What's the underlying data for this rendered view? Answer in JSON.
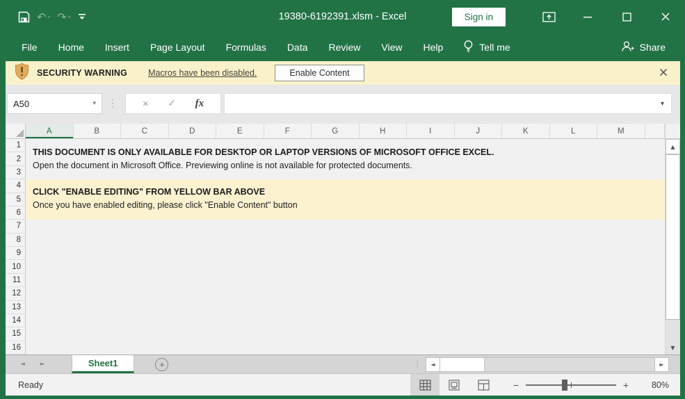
{
  "titlebar": {
    "title": "19380-6192391.xlsm  -  Excel",
    "sign_in_label": "Sign in"
  },
  "ribbon": {
    "tabs": [
      "File",
      "Home",
      "Insert",
      "Page Layout",
      "Formulas",
      "Data",
      "Review",
      "View",
      "Help"
    ],
    "tell_me_label": "Tell me",
    "share_label": "Share"
  },
  "security_bar": {
    "title": "SECURITY WARNING",
    "message_link": "Macros have been disabled.",
    "enable_button_label": "Enable Content"
  },
  "formula_bar": {
    "name_box_value": "A50",
    "fx_label": "fx",
    "formula_value": ""
  },
  "sheet": {
    "columns": [
      "A",
      "B",
      "C",
      "D",
      "E",
      "F",
      "G",
      "H",
      "I",
      "J",
      "K",
      "L",
      "M"
    ],
    "selected_column": "A",
    "rows": [
      "1",
      "2",
      "3",
      "4",
      "5",
      "6",
      "7",
      "8",
      "9",
      "10",
      "11",
      "12",
      "13",
      "14",
      "15",
      "16"
    ],
    "messages": {
      "line1_title": "THIS DOCUMENT IS ONLY AVAILABLE FOR DESKTOP OR LAPTOP VERSIONS OF MICROSOFT OFFICE EXCEL.",
      "line1_body": "Open the document in Microsoft Office. Previewing online is not available for protected documents.",
      "line2_title": "CLICK \"ENABLE EDITING\" FROM YELLOW BAR ABOVE",
      "line2_body": "Once you have enabled editing, please click \"Enable Content\" button"
    }
  },
  "sheet_tabs": {
    "active_tab": "Sheet1"
  },
  "status_bar": {
    "status": "Ready",
    "zoom_level": "80%"
  },
  "colors": {
    "excel_green": "#217346",
    "warning_bar_bg": "#f9f1c9",
    "highlight_cell_bg": "#fdf2d0"
  }
}
